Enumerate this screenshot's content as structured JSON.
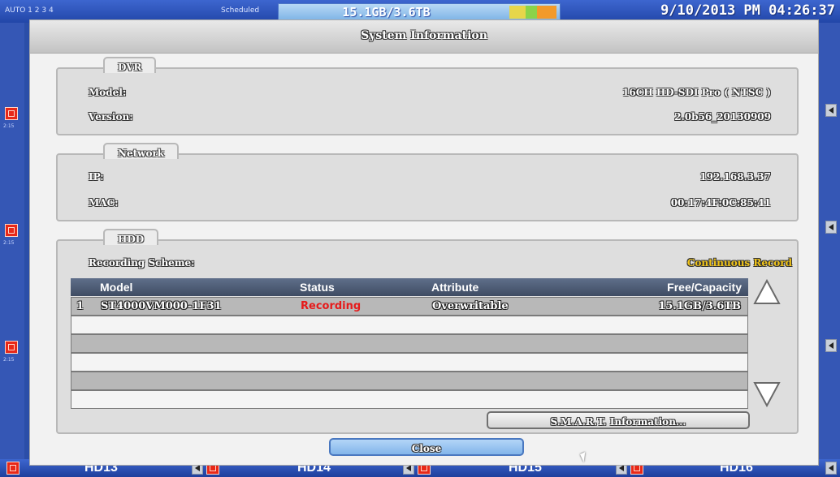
{
  "status_bar": {
    "left_label": "AUTO 1 2 3 4",
    "mid_label": "Scheduled",
    "hdd_usage": "15.1GB/3.6TB",
    "hdd_seg_colors": [
      "#e6d64a",
      "#8ad34a",
      "#f29a2a"
    ],
    "datetime": "9/10/2013 PM 04:26:37"
  },
  "channels": [
    "HD13",
    "HD14",
    "HD15",
    "HD16"
  ],
  "side_channel_labels": [
    "2:15",
    "2:15",
    "2:15"
  ],
  "dialog": {
    "title": "System Information",
    "dvr": {
      "tab": "DVR",
      "model_label": "Model:",
      "model_value": "16CH HD-SDI Pro ( NTSC )",
      "version_label": "Version:",
      "version_value": "2.0b56_20130909"
    },
    "network": {
      "tab": "Network",
      "ip_label": "IP:",
      "ip_value": "192.168.3.37",
      "mac_label": "MAC:",
      "mac_value": "00:17:4F:0C:85:41"
    },
    "hdd": {
      "tab": "HDD",
      "scheme_label": "Recording Scheme:",
      "scheme_value": "Continuous Record",
      "scheme_color": "#f0c419",
      "columns": [
        "Model",
        "Status",
        "Attribute",
        "Free/Capacity"
      ],
      "rows": [
        {
          "index": "1",
          "model": "ST4000VM000-1F31",
          "status": "Recording",
          "attribute": "Overwritable",
          "capacity": "15.1GB/3.6TB"
        }
      ],
      "empty_rows": 5,
      "smart_button": "S.M.A.R.T. Information..."
    },
    "close_button": "Close"
  }
}
